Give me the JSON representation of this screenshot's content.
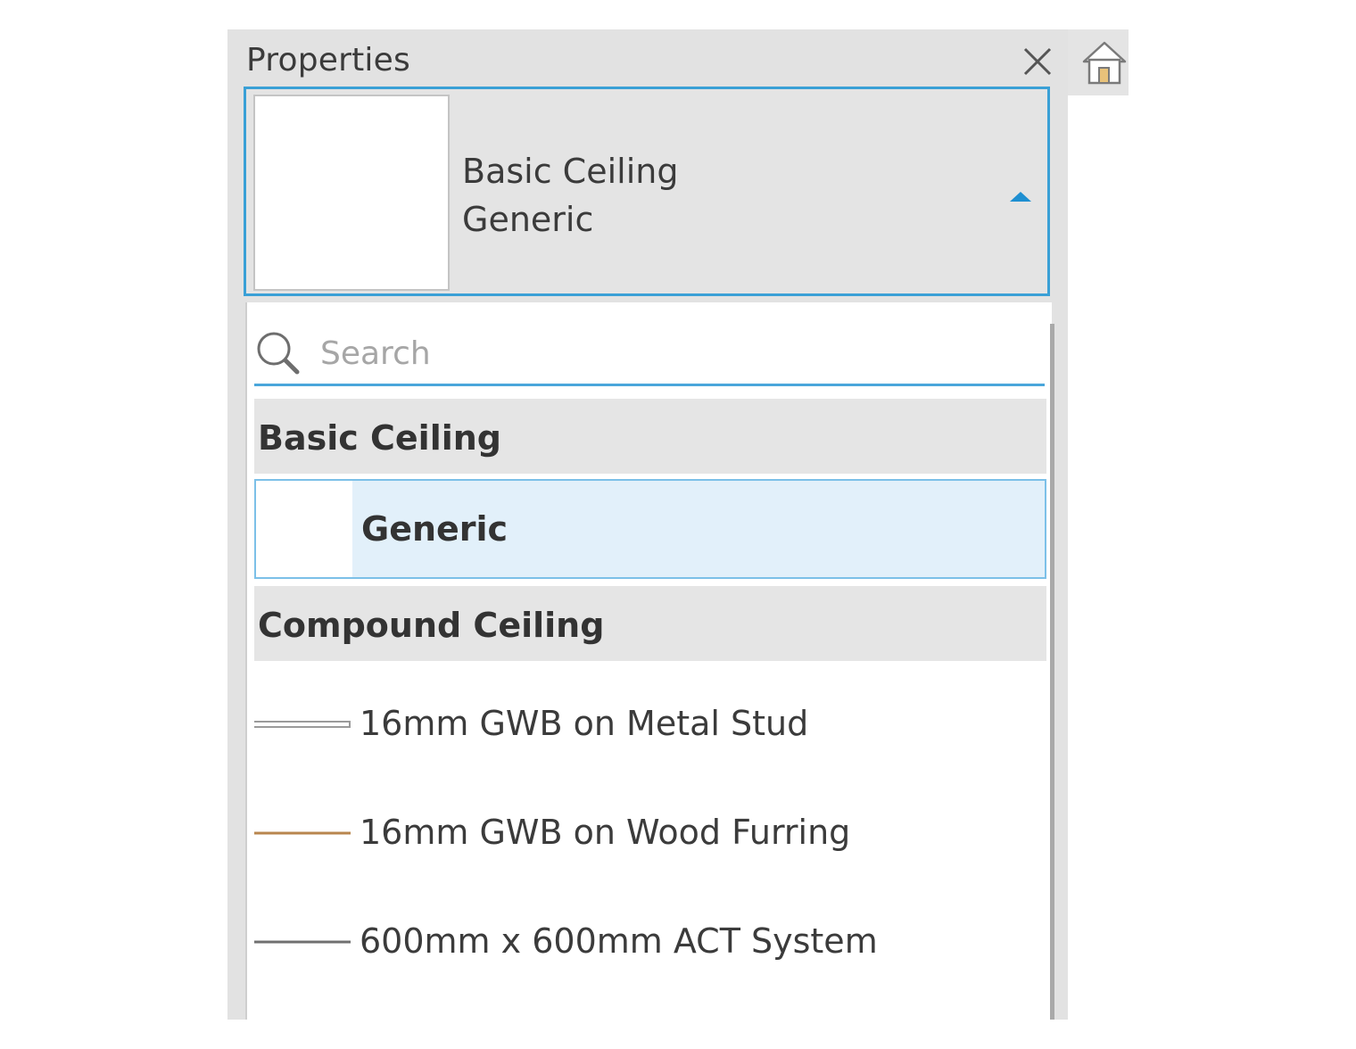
{
  "panel": {
    "title": "Properties",
    "close_icon": "close-icon"
  },
  "type_selector": {
    "family": "Basic Ceiling",
    "type": "Generic",
    "expanded": true
  },
  "dropdown": {
    "search": {
      "placeholder": "Search",
      "value": ""
    },
    "groups": [
      {
        "name": "Basic Ceiling",
        "items": [
          {
            "label": "Generic",
            "selected": true,
            "swatch": "blank"
          }
        ]
      },
      {
        "name": "Compound Ceiling",
        "items": [
          {
            "label": "16mm GWB on Metal Stud",
            "selected": false,
            "swatch": "double-gray-line",
            "color": "#9a9a9a"
          },
          {
            "label": "16mm GWB on Wood Furring",
            "selected": false,
            "swatch": "wood-line",
            "color": "#b8864e"
          },
          {
            "label": "600mm x 600mm ACT System",
            "selected": false,
            "swatch": "gray-line",
            "color": "#707070"
          }
        ]
      }
    ]
  },
  "side_toolbar": {
    "home_icon": "home-icon"
  },
  "colors": {
    "accent": "#3aa0d6",
    "selected_bg": "#e2f0fa",
    "panel_bg": "#e2e2e2"
  }
}
